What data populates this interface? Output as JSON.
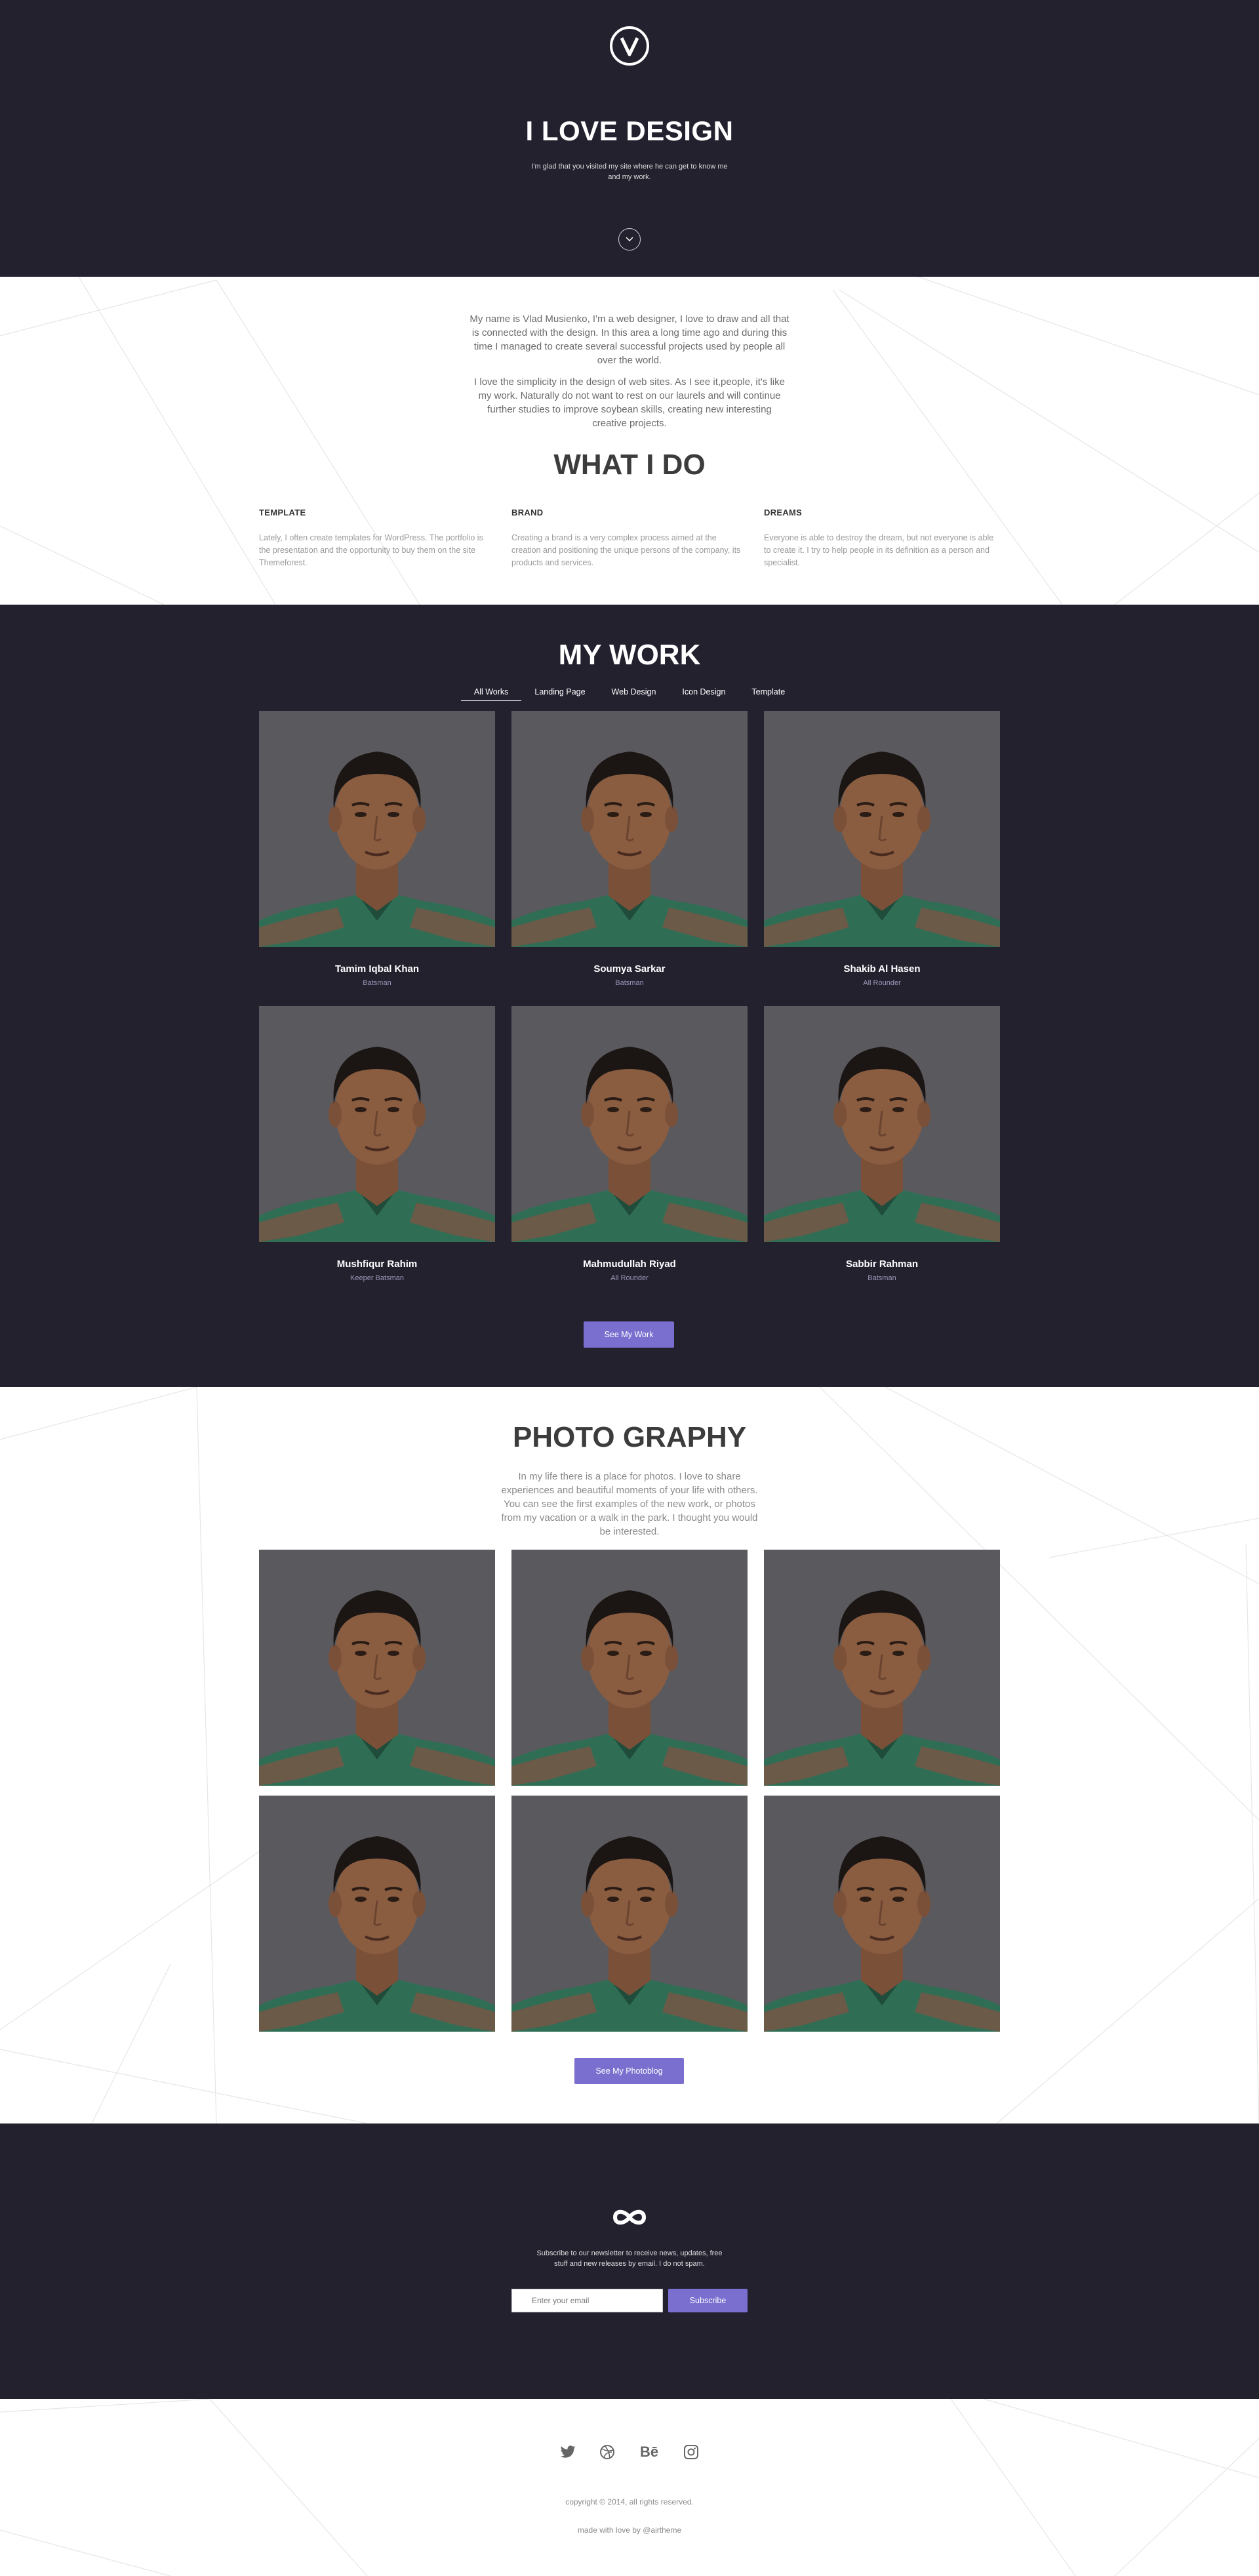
{
  "hero": {
    "title": "I LOVE DESIGN",
    "subtitle": "I'm glad that you visited my site where he can get to know me and my work."
  },
  "about": {
    "paragraphs": [
      "My name is Vlad Musienko, I'm a web designer, I love to draw and all that is connected with the design. In this area a long time ago and during this time I managed to create several successful projects used by people all over the world.",
      "I love the simplicity in the design of web sites. As I see it,people, it's like my work. Naturally do not want to rest on our laurels and will continue further studies to improve soybean skills, creating new interesting creative projects."
    ],
    "heading": "WHAT I DO",
    "columns": [
      {
        "title": "TEMPLATE",
        "text": "Lately, I often create templates for WordPress. The portfolio is the presentation and the opportunity to buy them on the site Themeforest."
      },
      {
        "title": "BRAND",
        "text": "Creating a brand is a very complex process aimed at the creation and positioning the unique persons of the company, its products and services."
      },
      {
        "title": "DREAMS",
        "text": "Everyone is able to destroy the dream, but not everyone is able to create it. I try to help people in its definition as a person and specialist."
      }
    ]
  },
  "work": {
    "heading": "MY WORK",
    "filters": [
      "All Works",
      "Landing Page",
      "Web Design",
      "Icon Design",
      "Template"
    ],
    "active_filter": 0,
    "cards": [
      {
        "name": "Tamim Iqbal Khan",
        "role": "Batsman"
      },
      {
        "name": "Soumya Sarkar",
        "role": "Batsman"
      },
      {
        "name": "Shakib Al Hasen",
        "role": "All Rounder"
      },
      {
        "name": "Mushfiqur Rahim",
        "role": "Keeper Batsman"
      },
      {
        "name": "Mahmudullah Riyad",
        "role": "All Rounder"
      },
      {
        "name": "Sabbir Rahman",
        "role": "Batsman"
      }
    ],
    "button": "See My Work"
  },
  "photography": {
    "heading": "PHOTO GRAPHY",
    "text": "In my life there is a place for photos. I love to share experiences and beautiful moments of your life with others. You can see the first examples of the new work, or photos from my vacation or a walk in the park. I thought you would be interested.",
    "photo_count": 6,
    "button": "See My Photoblog"
  },
  "newsletter": {
    "text": "Subscribe to our newsletter to receive news, updates, free stuff and new releases by email. I do not spam.",
    "placeholder": "Enter your email",
    "button": "Subscribe"
  },
  "footer": {
    "social_icons": [
      "twitter-icon",
      "dribbble-icon",
      "behance-icon",
      "instagram-icon"
    ],
    "behance_label": "Bē",
    "copyright": "copyright © 2014, all rights reserved.",
    "made": "made with love by @airtheme"
  },
  "colors": {
    "dark_bg": "#24212f",
    "accent": "#7a6fcf",
    "jersey_green": "#2f6e55",
    "photo_bg": "#5a595e"
  }
}
